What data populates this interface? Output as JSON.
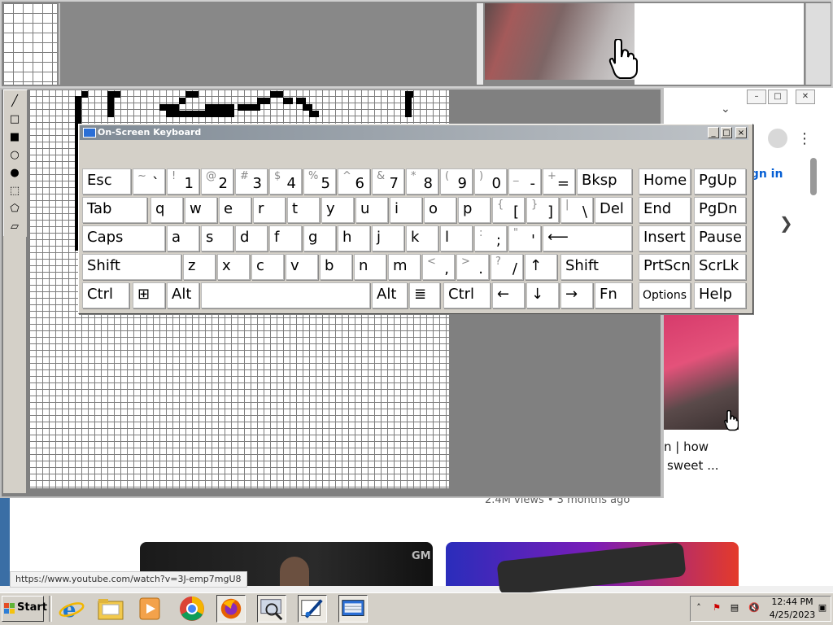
{
  "youtube": {
    "signin": "ign in",
    "video_title_line1": "n | how",
    "video_title_line2": "sweet ...",
    "video_meta": "2.4M views • 3 months ago",
    "thumb_logo": "GM",
    "status_url": "https://www.youtube.com/watch?v=3J-emp7mgU8"
  },
  "osk": {
    "title": "On-Screen Keyboard",
    "title_buttons": [
      "_",
      "□",
      "×"
    ],
    "rows": [
      [
        {
          "main": "Esc"
        },
        {
          "shift": "~",
          "base": "`"
        },
        {
          "shift": "!",
          "base": "1"
        },
        {
          "shift": "@",
          "base": "2"
        },
        {
          "shift": "#",
          "base": "3"
        },
        {
          "shift": "$",
          "base": "4"
        },
        {
          "shift": "%",
          "base": "5"
        },
        {
          "shift": "^",
          "base": "6"
        },
        {
          "shift": "&",
          "base": "7"
        },
        {
          "shift": "*",
          "base": "8"
        },
        {
          "shift": "(",
          "base": "9"
        },
        {
          "shift": ")",
          "base": "0"
        },
        {
          "shift": "_",
          "base": "-"
        },
        {
          "shift": "+",
          "base": "="
        },
        {
          "main": "Bksp"
        },
        {
          "main": "Home"
        },
        {
          "main": "PgUp"
        }
      ],
      [
        {
          "main": "Tab"
        },
        {
          "main": "q"
        },
        {
          "main": "w"
        },
        {
          "main": "e"
        },
        {
          "main": "r"
        },
        {
          "main": "t"
        },
        {
          "main": "y"
        },
        {
          "main": "u"
        },
        {
          "main": "i"
        },
        {
          "main": "o"
        },
        {
          "main": "p"
        },
        {
          "shift": "{",
          "base": "["
        },
        {
          "shift": "}",
          "base": "]"
        },
        {
          "shift": "|",
          "base": "\\"
        },
        {
          "main": "Del"
        },
        {
          "main": "End"
        },
        {
          "main": "PgDn"
        }
      ],
      [
        {
          "main": "Caps"
        },
        {
          "main": "a"
        },
        {
          "main": "s"
        },
        {
          "main": "d"
        },
        {
          "main": "f"
        },
        {
          "main": "g"
        },
        {
          "main": "h"
        },
        {
          "main": "j"
        },
        {
          "main": "k"
        },
        {
          "main": "l"
        },
        {
          "shift": ":",
          "base": ";"
        },
        {
          "shift": "\"",
          "base": "'"
        },
        {
          "main": "⟵"
        },
        {
          "main": "Insert"
        },
        {
          "main": "Pause"
        }
      ],
      [
        {
          "main": "Shift"
        },
        {
          "main": "z"
        },
        {
          "main": "x"
        },
        {
          "main": "c"
        },
        {
          "main": "v"
        },
        {
          "main": "b"
        },
        {
          "main": "n"
        },
        {
          "main": "m"
        },
        {
          "shift": "<",
          "base": ","
        },
        {
          "shift": ">",
          "base": "."
        },
        {
          "shift": "?",
          "base": "/"
        },
        {
          "main": "↑"
        },
        {
          "main": "Shift"
        },
        {
          "main": "PrtScn"
        },
        {
          "main": "ScrLk"
        }
      ],
      [
        {
          "main": "Ctrl"
        },
        {
          "main": "⊞"
        },
        {
          "main": "Alt"
        },
        {
          "main": ""
        },
        {
          "main": "Alt"
        },
        {
          "main": "≣"
        },
        {
          "main": "Ctrl"
        },
        {
          "main": "←"
        },
        {
          "main": "↓"
        },
        {
          "main": "→"
        },
        {
          "main": "Fn"
        },
        {
          "main": "Options"
        },
        {
          "main": "Help"
        }
      ]
    ]
  },
  "taskbar": {
    "start_label": "Start",
    "time": "12:44 PM",
    "date": "4/25/2023",
    "apps": [
      "internet-explorer-icon",
      "file-explorer-icon",
      "media-player-icon",
      "chrome-icon",
      "firefox-icon",
      "magnifier-icon",
      "paint-icon",
      "on-screen-keyboard-icon"
    ]
  },
  "colors": {
    "titlebar": "#7f8a95",
    "desktop_blue": "#3a6ea5",
    "youtube_link": "#065fd4"
  }
}
